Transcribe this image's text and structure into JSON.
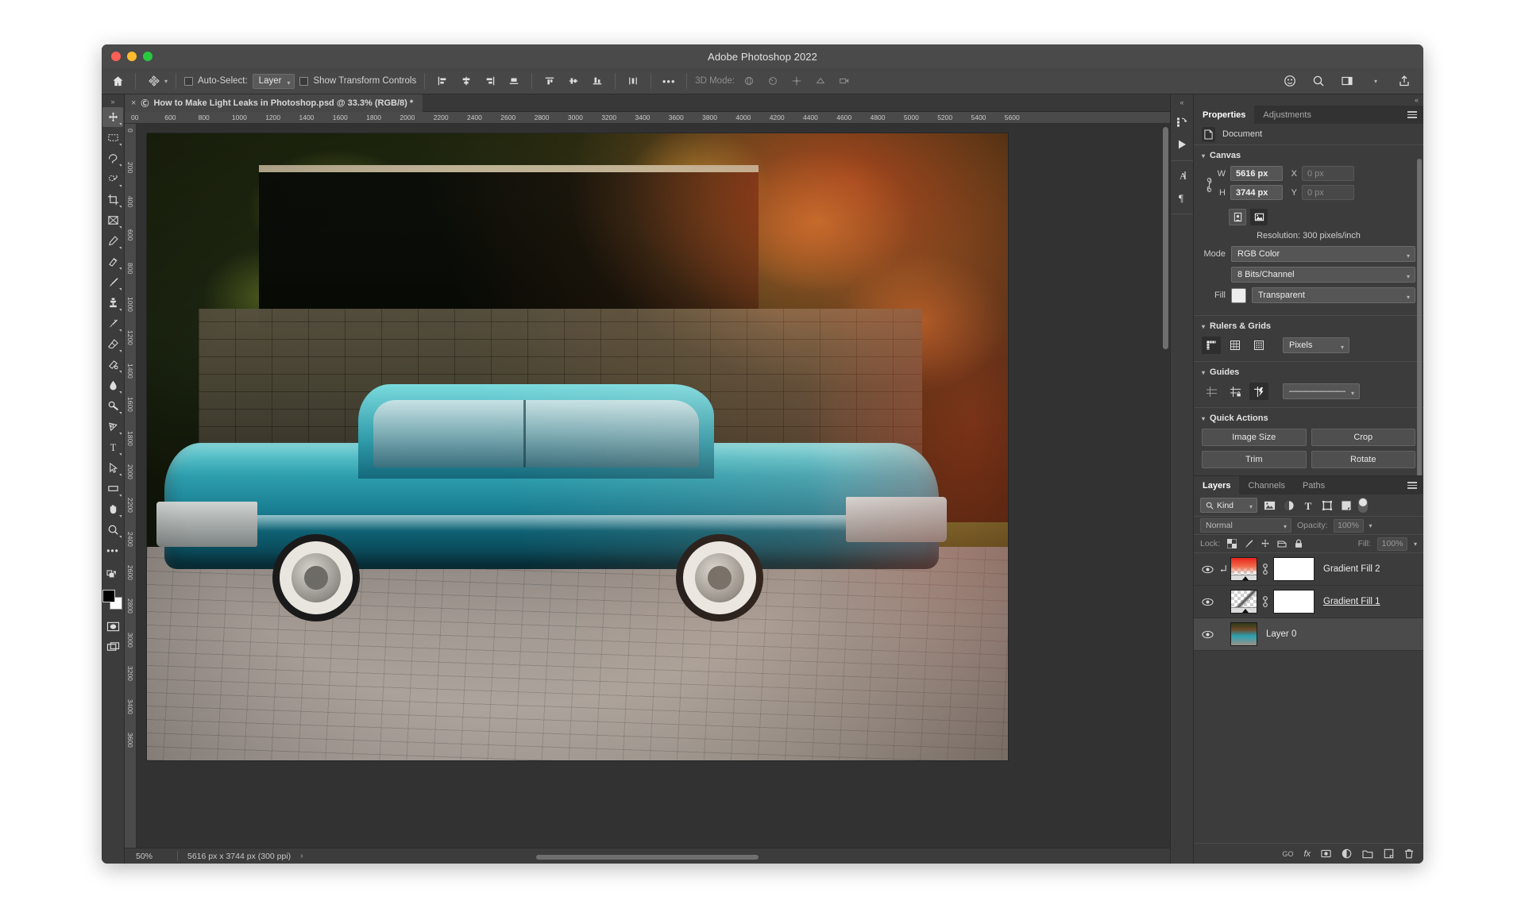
{
  "window": {
    "title": "Adobe Photoshop 2022"
  },
  "options_bar": {
    "home_icon": "home-icon",
    "tool_icon": "move-tool-icon",
    "auto_select_label": "Auto-Select:",
    "auto_select_value": "Layer",
    "show_transform_label": "Show Transform Controls",
    "more_label": "•••",
    "three_d_mode_label": "3D Mode:",
    "align_icons": [
      "align-left-edges-icon",
      "align-horizontal-centers-icon",
      "align-right-edges-icon",
      "align-bottom-edges-icon",
      "distribute-top-icon",
      "distribute-vertical-centers-icon",
      "distribute-bottom-icon",
      "distribute-horizontal-icon"
    ],
    "right_icons": [
      "help-search-icon",
      "search-icon",
      "workspace-icon",
      "chevron-down-icon",
      "share-icon"
    ]
  },
  "document_tab": {
    "close_label": "×",
    "cloud_icon": "cloud-document-icon",
    "title": "How to Make Light Leaks in Photoshop.psd @ 33.3% (RGB/8) *"
  },
  "toolbar": {
    "collapse_label": "»",
    "tools": [
      {
        "name": "move-tool",
        "selected": true
      },
      {
        "name": "rectangular-marquee-tool",
        "selected": false
      },
      {
        "name": "lasso-tool",
        "selected": false
      },
      {
        "name": "object-selection-tool",
        "selected": false
      },
      {
        "name": "crop-tool",
        "selected": false
      },
      {
        "name": "frame-tool",
        "selected": false
      },
      {
        "name": "eyedropper-tool",
        "selected": false
      },
      {
        "name": "spot-healing-brush-tool",
        "selected": false
      },
      {
        "name": "brush-tool",
        "selected": false
      },
      {
        "name": "clone-stamp-tool",
        "selected": false
      },
      {
        "name": "history-brush-tool",
        "selected": false
      },
      {
        "name": "eraser-tool",
        "selected": false
      },
      {
        "name": "gradient-tool",
        "selected": false
      },
      {
        "name": "blur-tool",
        "selected": false
      },
      {
        "name": "dodge-tool",
        "selected": false
      },
      {
        "name": "pen-tool",
        "selected": false
      },
      {
        "name": "type-tool",
        "selected": false
      },
      {
        "name": "path-selection-tool",
        "selected": false
      },
      {
        "name": "rectangle-tool",
        "selected": false
      },
      {
        "name": "hand-tool",
        "selected": false
      },
      {
        "name": "zoom-tool",
        "selected": false
      },
      {
        "name": "edit-toolbar",
        "selected": false
      }
    ],
    "swatch_foreground": "#000000",
    "swatch_background": "#ffffff",
    "quick_mask_icon": "quick-mask-icon",
    "screen_mode_icon": "screen-mode-icon"
  },
  "rulers": {
    "unit": "Pixels",
    "top_ticks": [
      "00",
      "600",
      "800",
      "1000",
      "1200",
      "1400",
      "1600",
      "1800",
      "2000",
      "2200",
      "2400",
      "2600",
      "2800",
      "3000",
      "3200",
      "3400",
      "3600",
      "3800",
      "4000",
      "4200",
      "4400",
      "4600",
      "4800",
      "5000",
      "5200",
      "5400",
      "5600"
    ],
    "left_ticks": [
      "0",
      "200",
      "400",
      "600",
      "800",
      "1000",
      "1200",
      "1400",
      "1600",
      "1800",
      "2000",
      "2200",
      "2400",
      "2600",
      "2800",
      "3000",
      "3200",
      "3400",
      "3600"
    ]
  },
  "status_bar": {
    "zoom": "50%",
    "doc_size": "5616 px x 3744 px (300 ppi)",
    "arrow": "›"
  },
  "rail": {
    "collapse_label": "«",
    "icons": [
      "libraries-icon",
      "actions-play-icon",
      "character-icon",
      "paragraph-icon"
    ],
    "far_icons": [
      "collapse-icon",
      "color-panel-icon",
      "history-panel-icon"
    ]
  },
  "properties_panel": {
    "collapse_label": "«",
    "tabs": [
      {
        "label": "Properties",
        "active": true
      },
      {
        "label": "Adjustments",
        "active": false
      }
    ],
    "menu_icon": "panel-menu-icon",
    "doc_row": {
      "icon": "document-icon",
      "label": "Document"
    },
    "canvas": {
      "title": "Canvas",
      "w_label": "W",
      "w_value": "5616 px",
      "h_label": "H",
      "h_value": "3744 px",
      "x_label": "X",
      "x_value": "0 px",
      "y_label": "Y",
      "y_value": "0 px",
      "link_icon": "link-icon",
      "orientation_portrait": "portrait-orientation-icon",
      "orientation_landscape": "landscape-orientation-icon",
      "resolution": "Resolution: 300 pixels/inch",
      "mode_label": "Mode",
      "mode_value": "RGB Color",
      "depth_value": "8 Bits/Channel",
      "fill_label": "Fill",
      "fill_value": "Transparent"
    },
    "rulers_grids": {
      "title": "Rulers & Grids",
      "icons": [
        "rulers-icon",
        "grid-icon",
        "transparency-grid-icon"
      ],
      "unit_value": "Pixels"
    },
    "guides": {
      "title": "Guides",
      "icons": [
        "show-guides-icon",
        "lock-guides-icon",
        "snap-to-guides-icon"
      ],
      "style_value": "———————"
    },
    "quick_actions": {
      "title": "Quick Actions",
      "buttons": [
        "Image Size",
        "Crop",
        "Trim",
        "Rotate"
      ]
    }
  },
  "layers_panel": {
    "tabs": [
      {
        "label": "Layers",
        "active": true
      },
      {
        "label": "Channels",
        "active": false
      },
      {
        "label": "Paths",
        "active": false
      }
    ],
    "menu_icon": "panel-menu-icon",
    "filter": {
      "search_icon": "search-icon",
      "kind_label": "Kind",
      "filter_icons": [
        "filter-pixel-icon",
        "filter-adjustment-icon",
        "filter-type-icon",
        "filter-shape-icon",
        "filter-smart-object-icon"
      ],
      "toggle_icon": "filter-toggle"
    },
    "blend": {
      "mode_value": "Normal",
      "opacity_label": "Opacity:",
      "opacity_value": "100%"
    },
    "lock": {
      "label": "Lock:",
      "icons": [
        "lock-transparent-pixels-icon",
        "lock-image-pixels-icon",
        "lock-position-icon",
        "lock-artboard-icon",
        "lock-all-icon"
      ],
      "fill_label": "Fill:",
      "fill_value": "100%"
    },
    "layers": [
      {
        "name": "Gradient Fill 2",
        "visible": true,
        "clipped": true,
        "thumb": "gradient-red",
        "has_mask": true,
        "selected": false,
        "underlined": false
      },
      {
        "name": "Gradient Fill 1",
        "visible": true,
        "clipped": false,
        "thumb": "gradient-gray",
        "has_mask": true,
        "selected": false,
        "underlined": true
      },
      {
        "name": "Layer 0",
        "visible": true,
        "clipped": false,
        "thumb": "photo",
        "has_mask": false,
        "selected": true,
        "underlined": false
      }
    ],
    "footer_icons": [
      "link-layers-icon",
      "layer-style-fx-icon",
      "add-mask-icon",
      "new-adjustment-layer-icon",
      "new-group-icon",
      "new-layer-icon",
      "delete-layer-icon"
    ],
    "footer_labels": {
      "link": "GO",
      "fx": "fx"
    }
  }
}
